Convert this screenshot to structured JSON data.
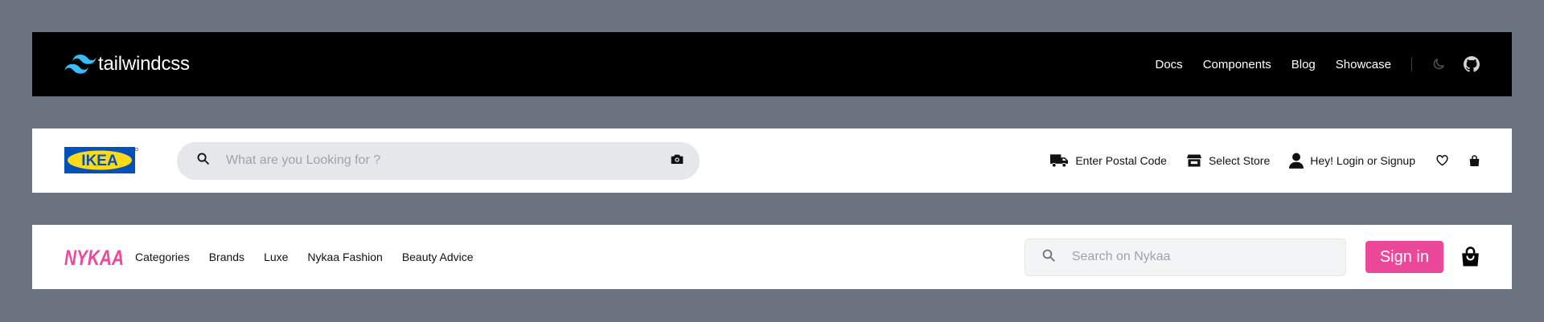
{
  "tailwind": {
    "logo_text": "tailwindcss",
    "nav": [
      {
        "label": "Docs"
      },
      {
        "label": "Components"
      },
      {
        "label": "Blog"
      },
      {
        "label": "Showcase"
      }
    ],
    "icons": [
      "moon-icon",
      "github-icon"
    ],
    "accent": "#38bdf8"
  },
  "ikea": {
    "logo_text": "IKEA",
    "logo_colors": {
      "blue": "#0051ba",
      "yellow": "#ffda1a"
    },
    "search_placeholder": "What are you Looking for ?",
    "actions": [
      {
        "label": "Enter Postal Code",
        "icon": "truck-icon"
      },
      {
        "label": "Select Store",
        "icon": "store-icon"
      },
      {
        "label": "Hey! Login or Signup",
        "icon": "user-icon"
      }
    ],
    "icons": [
      "camera-icon",
      "heart-icon",
      "bag-icon"
    ]
  },
  "nykaa": {
    "logo_text": "NYKAA",
    "nav": [
      {
        "label": "Categories"
      },
      {
        "label": "Brands"
      },
      {
        "label": "Luxe"
      },
      {
        "label": "Nykaa Fashion"
      },
      {
        "label": "Beauty Advice"
      }
    ],
    "search_placeholder": "Search on Nykaa",
    "signin_label": "Sign in",
    "brand_color": "#ec4899",
    "icons": [
      "search-icon",
      "bag-icon"
    ]
  }
}
